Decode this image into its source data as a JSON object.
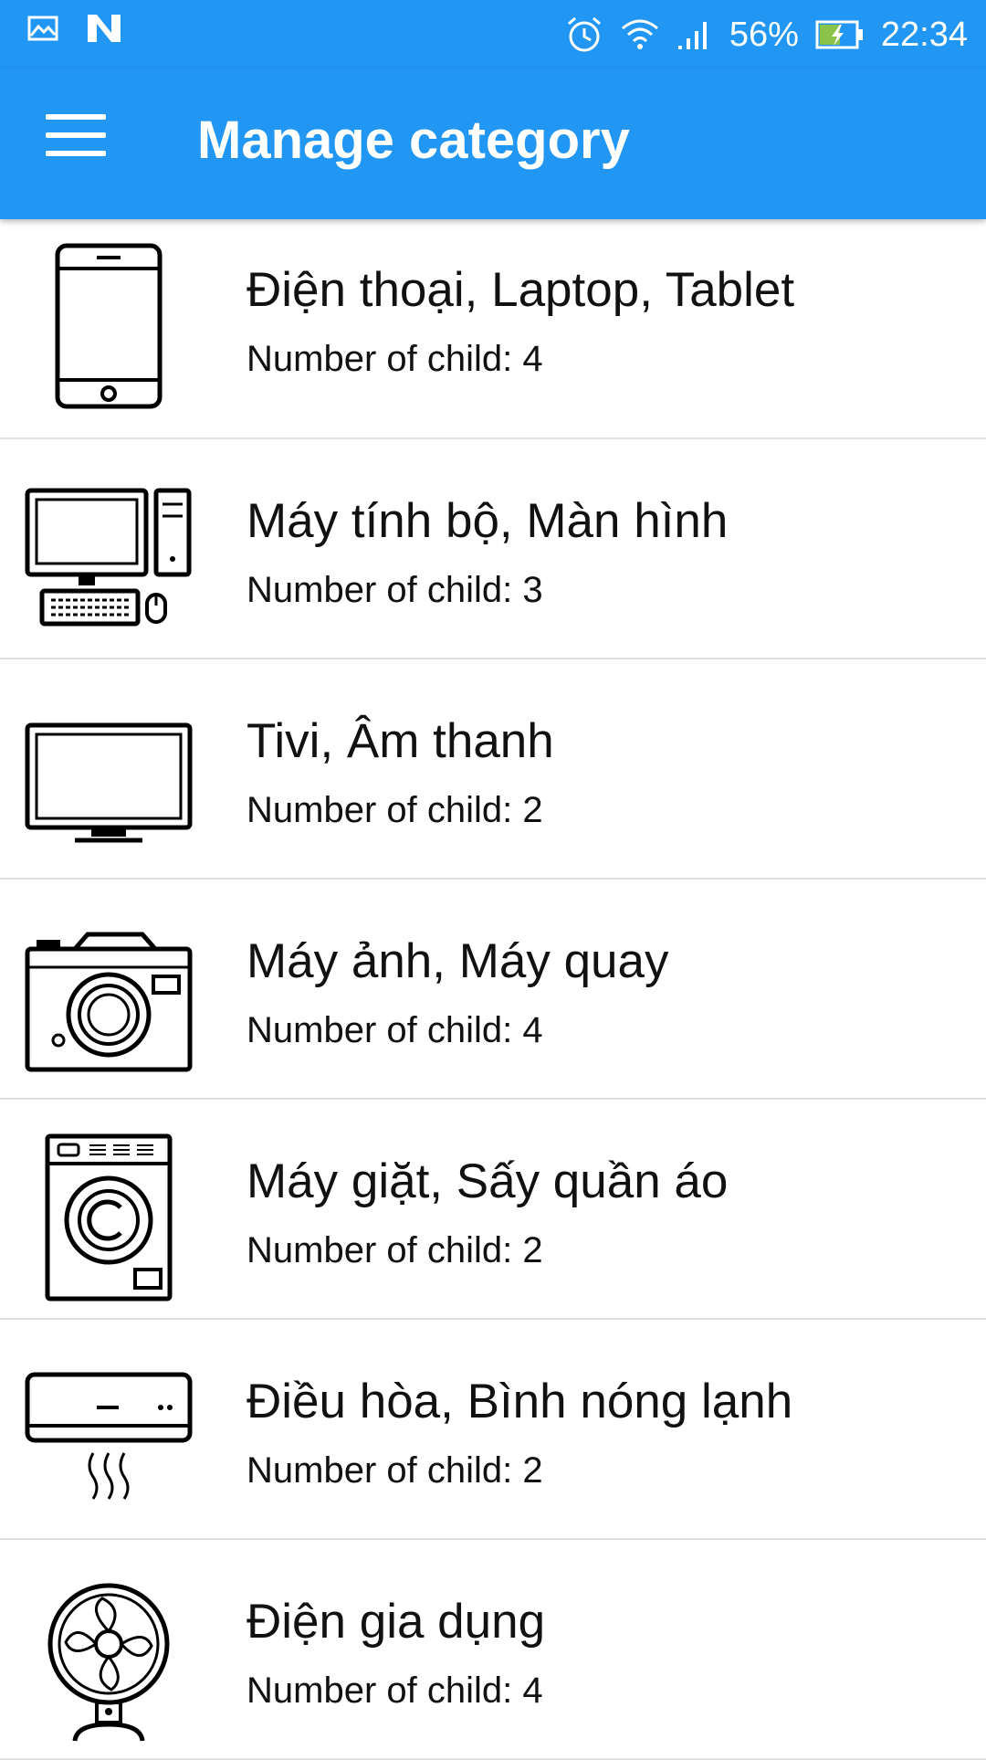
{
  "status_bar": {
    "battery": "56%",
    "time": "22:34",
    "icons": [
      "gallery-icon",
      "n-logo-icon",
      "alarm-icon",
      "wifi-icon",
      "signal-icon",
      "battery-charging-icon"
    ]
  },
  "app_bar": {
    "title": "Manage category",
    "menu_icon": "hamburger-menu-icon",
    "color": "#2196f3"
  },
  "categories": [
    {
      "name": "Điện thoại, Laptop, Tablet",
      "count_text": "Number of child: 4",
      "icon": "smartphone-icon"
    },
    {
      "name": "Máy tính bộ, Màn hình",
      "count_text": "Number of child: 3",
      "icon": "desktop-computer-icon"
    },
    {
      "name": "Tivi, Âm thanh",
      "count_text": "Number of child: 2",
      "icon": "tv-icon"
    },
    {
      "name": "Máy ảnh, Máy quay",
      "count_text": "Number of child: 4",
      "icon": "camera-icon"
    },
    {
      "name": "Máy giặt, Sấy quần áo",
      "count_text": "Number of child: 2",
      "icon": "washing-machine-icon"
    },
    {
      "name": "Điều hòa, Bình nóng lạnh",
      "count_text": "Number of child: 2",
      "icon": "air-conditioner-icon"
    },
    {
      "name": "Điện gia dụng",
      "count_text": "Number of child: 4",
      "icon": "fan-icon"
    }
  ]
}
